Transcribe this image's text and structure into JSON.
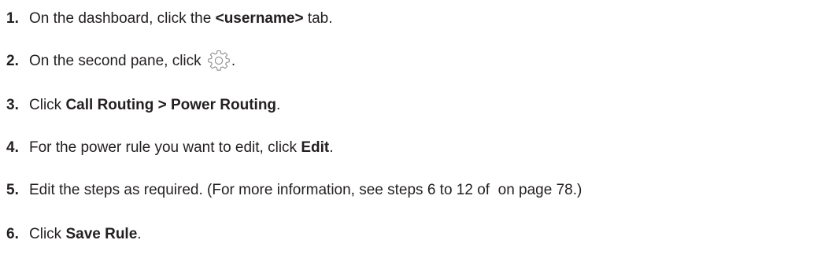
{
  "steps": [
    {
      "number": "1.",
      "pre": "On the dashboard, click the ",
      "bold": "<username>",
      "post": " tab."
    },
    {
      "number": "2.",
      "pre": "On the second pane, click ",
      "icon": "gear-icon",
      "post": "."
    },
    {
      "number": "3.",
      "pre": "Click ",
      "bold": "Call Routing > Power Routing",
      "post": "."
    },
    {
      "number": "4.",
      "pre": "For the power rule you want to edit, click ",
      "bold": "Edit",
      "post": "."
    },
    {
      "number": "5.",
      "text": "Edit the steps as required. (For more information, see steps 6 to 12 of  on page 78.)"
    },
    {
      "number": "6.",
      "pre": "Click ",
      "bold": "Save Rule",
      "post": "."
    }
  ]
}
